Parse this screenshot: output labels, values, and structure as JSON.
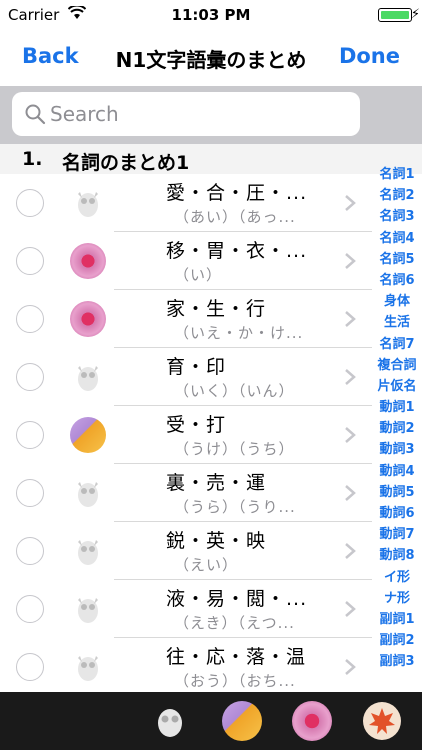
{
  "status": {
    "carrier": "Carrier",
    "time": "11:03 PM"
  },
  "nav": {
    "back": "Back",
    "title": "N1文字語彙のまとめ",
    "done": "Done"
  },
  "search": {
    "placeholder": "Search"
  },
  "section": {
    "number": "1.",
    "title": "名詞のまとめ1"
  },
  "rows": [
    {
      "kanji": "愛・合・圧・...",
      "reading": "（あい）（あっ...",
      "icon": "owl"
    },
    {
      "kanji": "移・胃・衣・...",
      "reading": "（い）",
      "icon": "flower-pink"
    },
    {
      "kanji": "家・生・行",
      "reading": "（いえ・か・け...",
      "icon": "flower-pink"
    },
    {
      "kanji": "育・印",
      "reading": "（いく）（いん）",
      "icon": "owl"
    },
    {
      "kanji": "受・打",
      "reading": "（うけ）（うち）",
      "icon": "flower-orange"
    },
    {
      "kanji": "裏・売・運",
      "reading": "（うら）（うり...",
      "icon": "owl"
    },
    {
      "kanji": "鋭・英・映",
      "reading": "（えい）",
      "icon": "owl"
    },
    {
      "kanji": "液・易・閲・...",
      "reading": "（えき）（えつ...",
      "icon": "owl"
    },
    {
      "kanji": "往・応・落・温",
      "reading": "（おう）（おち...",
      "icon": "owl"
    }
  ],
  "index": [
    "名詞1",
    "名詞2",
    "名詞3",
    "名詞4",
    "名詞5",
    "名詞6",
    "身体",
    "生活",
    "名詞7",
    "複合詞",
    "片仮名",
    "動詞1",
    "動詞2",
    "動詞3",
    "動詞4",
    "動詞5",
    "動詞6",
    "動詞7",
    "動詞8",
    "イ形",
    "ナ形",
    "副詞1",
    "副詞2",
    "副詞3"
  ],
  "tabs": [
    "owl-icon",
    "flower-orange-icon",
    "flower-pink-icon",
    "maple-leaf-icon"
  ],
  "colors": {
    "accent": "#1a73e8",
    "battery": "#4cd964"
  }
}
